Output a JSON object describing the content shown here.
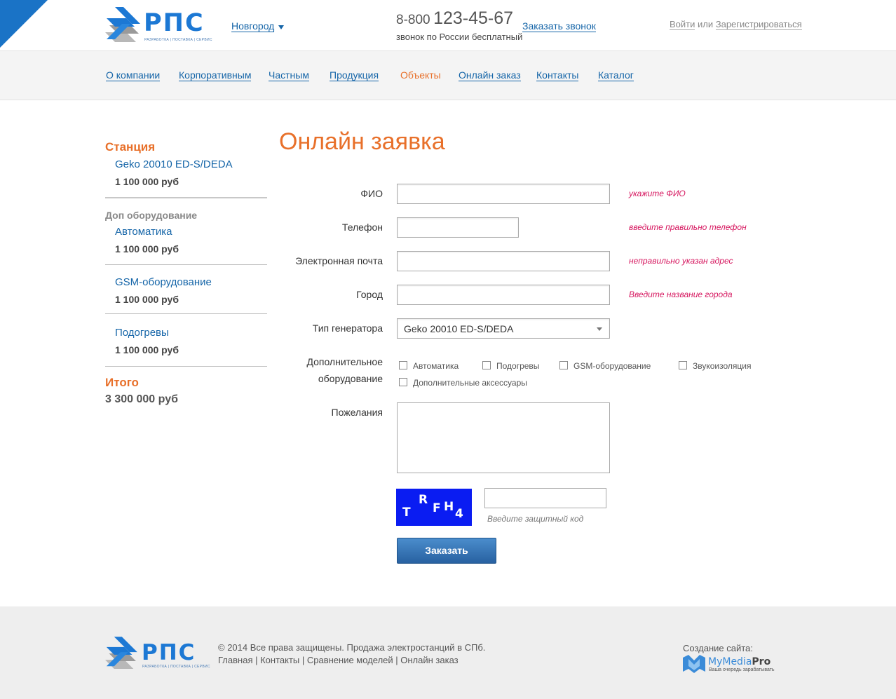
{
  "header": {
    "logo_text": "РПС",
    "logo_tagline": "РАЗРАБОТКА | ПОСТАВКА | СЕРВИС",
    "city": "Новгород",
    "phone_prefix": "8-800",
    "phone_number": "123-45-67",
    "phone_note": "звонок по России бесплатный",
    "callback_label": "Заказать звонок",
    "login_label": "Войти",
    "or_label": "или",
    "register_label": "Зарегистрироваться"
  },
  "nav": {
    "items": [
      "О компании",
      "Корпоративным",
      "Частным",
      "Продукция",
      "Объекты",
      "Онлайн заказ",
      "Контакты",
      "Каталог"
    ],
    "active": "Объекты"
  },
  "sidebar": {
    "station_title": "Станция",
    "station_name": "Geko 20010 ED-S/DEDA",
    "station_price": "1 100 000 руб",
    "extra_title": "Доп оборудование",
    "extras": [
      {
        "name": "Автоматика",
        "price": "1 100 000 руб"
      },
      {
        "name": "GSM-оборудование",
        "price": "1 100 000 руб"
      },
      {
        "name": "Подогревы",
        "price": "1 100 000 руб"
      }
    ],
    "total_title": "Итого",
    "total_value": "3 300 000 руб"
  },
  "form": {
    "title": "Онлайн заявка",
    "fio_label": "ФИО",
    "fio_error": "укажите ФИО",
    "phone_label": "Телефон",
    "phone_error": "введите правильно телефон",
    "email_label": "Электронная почта",
    "email_error": "неправильно указан адрес",
    "city_label": "Город",
    "city_error": "Введите название города",
    "generator_label": "Тип генератора",
    "generator_value": "Geko 20010 ED-S/DEDA",
    "extra_label_1": "Дополнительное",
    "extra_label_2": "оборудование",
    "checkboxes": [
      "Автоматика",
      "Подогревы",
      "GSM-оборудование",
      "Звукоизоляция",
      "Дополнительные аксессуары"
    ],
    "wishes_label": "Пожелания",
    "captcha_chars": [
      "T",
      "R",
      "F",
      "H",
      "4"
    ],
    "captcha_hint": "Введите защитный код",
    "submit_label": "Заказать"
  },
  "footer": {
    "copyright": "© 2014 Все права защищены. Продажа электростанций в СПб.",
    "links": [
      "Главная",
      "Контакты",
      "Сравнение моделей",
      "Онлайн заказ"
    ],
    "made_by_label": "Создание сайта:",
    "studio_name_a": "MyMedia",
    "studio_name_b": "Pro",
    "studio_tagline": "Ваша очередь зарабатывать"
  },
  "colors": {
    "accent": "#e8702a",
    "link": "#1565a8",
    "error": "#d6175f",
    "brand_blue": "#1c78d4"
  }
}
